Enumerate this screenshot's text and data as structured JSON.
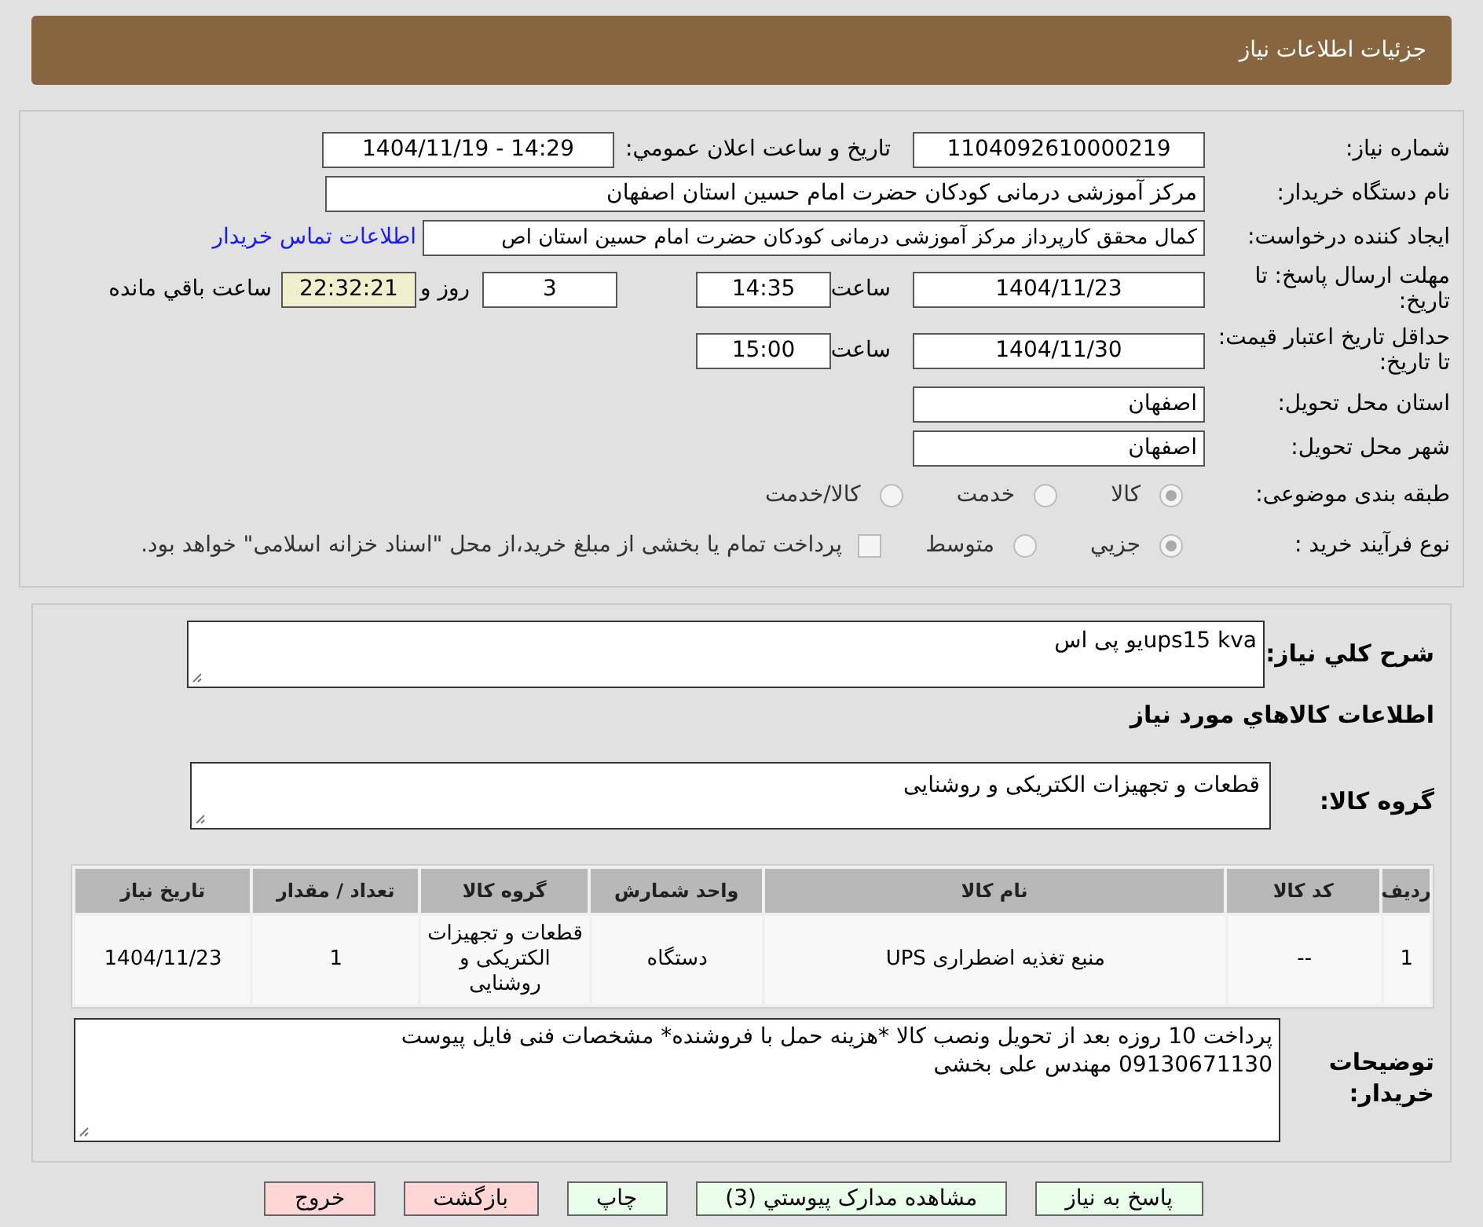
{
  "header": {
    "title": "جزئیات اطلاعات نیاز"
  },
  "need": {
    "number_label": "شماره نیاز:",
    "number": "1104092610000219",
    "announce_label": "تاريخ و ساعت اعلان عمومي:",
    "announce": "1404/11/19 - 14:29",
    "buyer_label": "نام دستگاه خریدار:",
    "buyer": "مرکز آموزشی درمانی کودکان حضرت امام حسین استان اصفهان",
    "creator_label": "ایجاد کننده درخواست:",
    "creator": "کمال محقق کارپرداز مرکز آموزشی درمانی کودکان حضرت امام حسین استان اص",
    "contact_link": "اطلاعات تماس خریدار",
    "deadline_label": "مهلت ارسال پاسخ: تا تاریخ:",
    "deadline_date": "1404/11/23",
    "time_label": "ساعت",
    "deadline_time": "14:35",
    "days": "3",
    "days_label": "روز و",
    "remaining": "22:32:21",
    "remaining_label": "ساعت باقي مانده",
    "validity_label": "حداقل تاریخ اعتبار قیمت: تا تاریخ:",
    "validity_date": "1404/11/30",
    "validity_time_label": "ساعت",
    "validity_time": "15:00",
    "province_label": "استان محل تحویل:",
    "province": "اصفهان",
    "city_label": "شهر محل تحویل:",
    "city": "اصفهان",
    "category_label": "طبقه بندی موضوعی:",
    "category_options": [
      {
        "label": "کالا",
        "selected": true
      },
      {
        "label": "خدمت",
        "selected": false
      },
      {
        "label": "کالا/خدمت",
        "selected": false
      }
    ],
    "process_label": "نوع فرآیند خرید :",
    "process_options": [
      {
        "label": "جزيي",
        "selected": true
      },
      {
        "label": "متوسط",
        "selected": false
      }
    ],
    "treasury": {
      "label": "پرداخت تمام یا بخشی از مبلغ خرید،از محل \"اسناد خزانه اسلامی\" خواهد بود.",
      "checked": false
    }
  },
  "details": {
    "summary_label": "شرح كلي نياز:",
    "summary": "ups15 kvaیو پی اس",
    "goods_heading": "اطلاعات كالاهاي مورد نياز",
    "group_label": "گروه کالا:",
    "group": "قطعات و تجهیزات الکتریکی و روشنایی",
    "table": {
      "columns": [
        "ردیف",
        "کد کالا",
        "نام کالا",
        "واحد شمارش",
        "گروه کالا",
        "تعداد / مقدار",
        "تاریخ نیاز"
      ],
      "rows": [
        [
          "1",
          "--",
          "منبع تغذیه اضطراری UPS",
          "دستگاه",
          "قطعات و تجهیزات الکتریکی و روشنایی",
          "1",
          "1404/11/23"
        ]
      ]
    },
    "notes_label": "توضیحات خریدار:",
    "notes": [
      "پرداخت 10 روزه بعد از تحویل ونصب کالا *هزینه حمل با فروشنده* مشخصات فنی فایل پیوست",
      "09130671130 مهندس علی بخشی"
    ]
  },
  "buttons": [
    {
      "label": "پاسخ به نیاز",
      "kind": "primary"
    },
    {
      "label": "مشاهده مدارک پیوستي (3)",
      "kind": "primary"
    },
    {
      "label": "چاپ",
      "kind": "primary"
    },
    {
      "label": "بازگشت",
      "kind": "danger"
    },
    {
      "label": "خروج",
      "kind": "danger"
    }
  ]
}
